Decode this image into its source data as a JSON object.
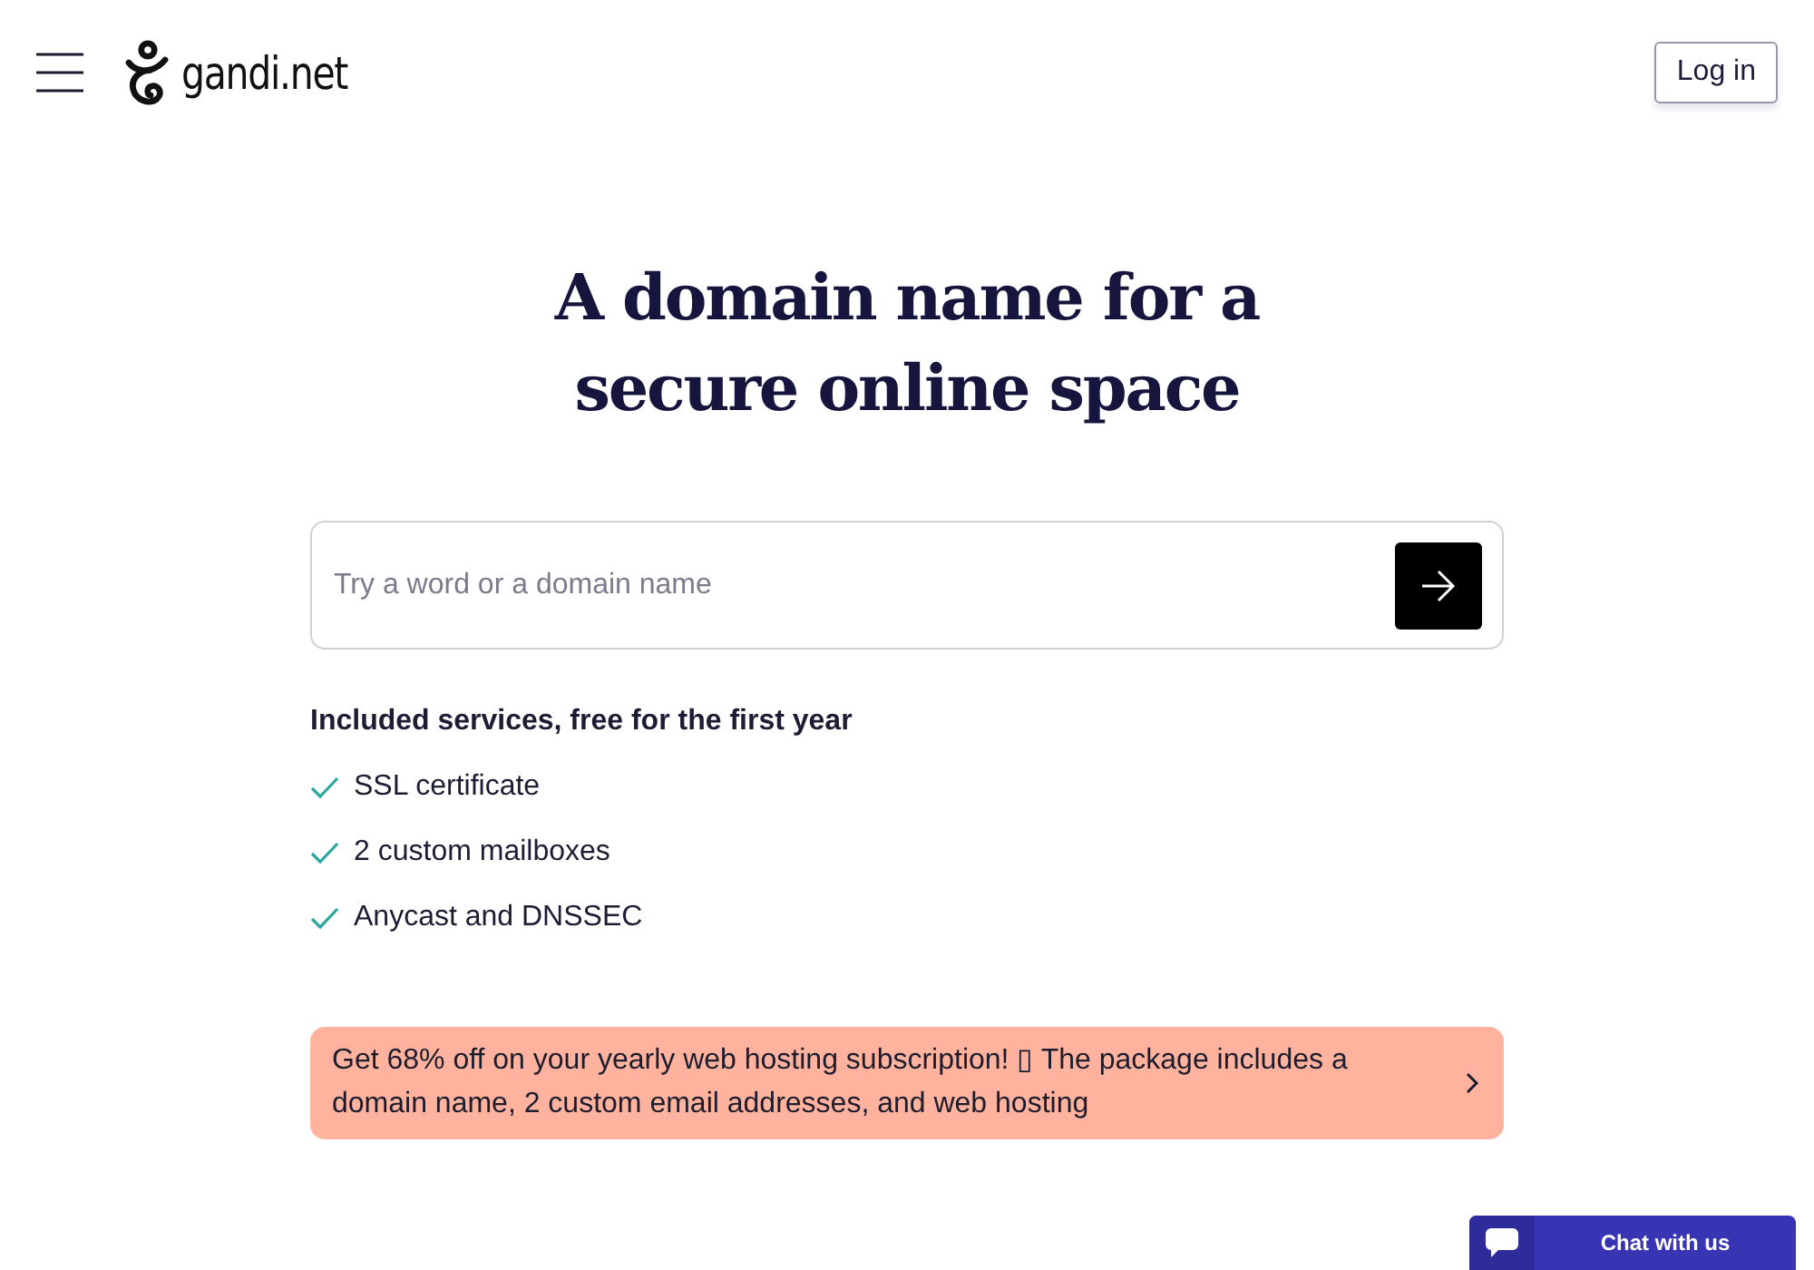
{
  "header": {
    "logo_text": "gandi.net",
    "login_button": "Log in"
  },
  "hero": {
    "title": "A domain name for a secure online space"
  },
  "search": {
    "placeholder": "Try a word or a domain name"
  },
  "services": {
    "heading": "Included services, free for the first year",
    "items": [
      {
        "label": "SSL certificate"
      },
      {
        "label": "2 custom mailboxes"
      },
      {
        "label": "Anycast and DNSSEC"
      }
    ]
  },
  "promo_banner": {
    "text": "Get 68% off on your yearly web hosting subscription! ▯ The package includes a domain name, 2 custom email addresses, and web hosting"
  },
  "chat_widget": {
    "label": "Chat with us"
  }
}
